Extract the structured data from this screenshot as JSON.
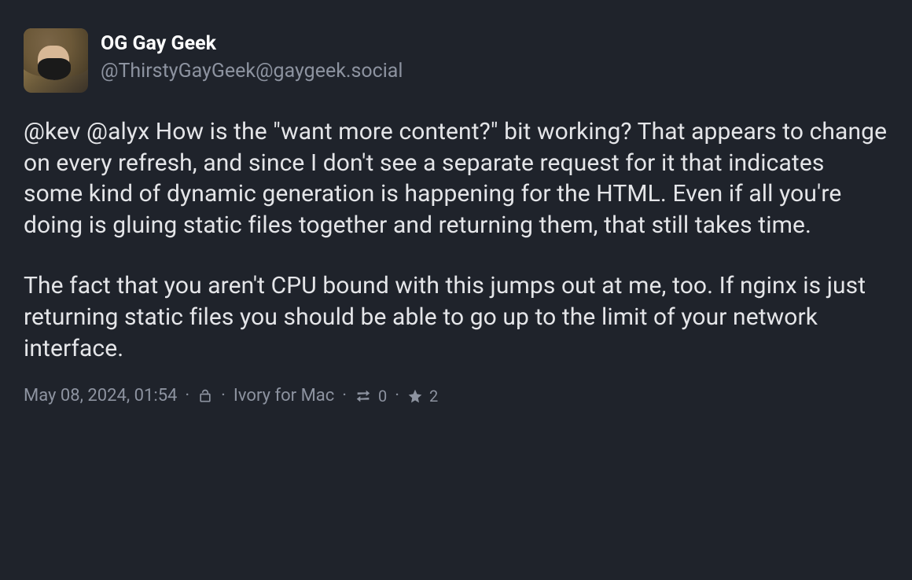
{
  "post": {
    "author": {
      "display_name": "OG Gay Geek",
      "handle": "@ThirstyGayGeek@gaygeek.social"
    },
    "content": {
      "mentions": [
        "@kev",
        "@alyx"
      ],
      "paragraph1_prefix": "@kev @alyx ",
      "paragraph1_body": "How is the \"want more content?\" bit working? That appears to change on every refresh, and since I don't see a separate request for it that indicates some kind of dynamic generation is happening for the HTML.  Even if all you're doing is gluing static files together and returning them, that still takes time.",
      "paragraph2": "The fact that you aren't CPU bound with this jumps out at me, too.  If nginx is just returning static files you should be able to go up to the limit of your network interface."
    },
    "meta": {
      "timestamp": "May 08, 2024, 01:54",
      "client": "Ivory for Mac",
      "boost_count": "0",
      "favorite_count": "2",
      "sep": "·"
    }
  }
}
